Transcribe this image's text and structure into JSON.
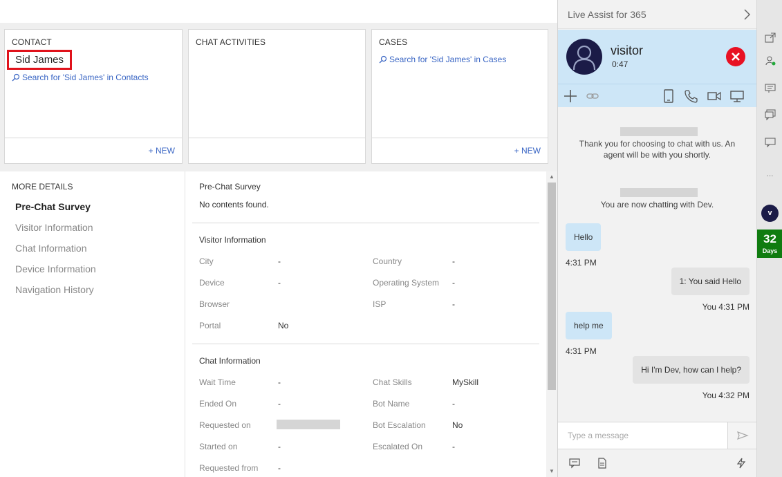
{
  "crm": {
    "contact_card": {
      "title": "CONTACT",
      "name": "Sid James",
      "search_link": "Search for 'Sid James' in Contacts",
      "new_label": "+ NEW"
    },
    "chat_activities_card": {
      "title": "CHAT ACTIVITIES"
    },
    "cases_card": {
      "title": "CASES",
      "search_link": "Search for 'Sid James' in Cases",
      "new_label": "+ NEW"
    },
    "more_details": {
      "header": "MORE DETAILS",
      "items": [
        "Pre-Chat Survey",
        "Visitor Information",
        "Chat Information",
        "Device Information",
        "Navigation History"
      ]
    },
    "pre_chat": {
      "title": "Pre-Chat Survey",
      "empty_text": "No contents found."
    },
    "visitor_info": {
      "title": "Visitor Information",
      "fields": [
        {
          "label": "City",
          "value": "-"
        },
        {
          "label": "Country",
          "value": "-"
        },
        {
          "label": "Device",
          "value": "-"
        },
        {
          "label": "Operating System",
          "value": "-"
        },
        {
          "label": "Browser",
          "value": ""
        },
        {
          "label": "ISP",
          "value": "-"
        },
        {
          "label": "Portal",
          "value": "No"
        }
      ]
    },
    "chat_info": {
      "title": "Chat Information",
      "fields": [
        {
          "label": "Wait Time",
          "value": "-"
        },
        {
          "label": "Chat Skills",
          "value": "MySkill"
        },
        {
          "label": "Ended On",
          "value": "-"
        },
        {
          "label": "Bot Name",
          "value": "-"
        },
        {
          "label": "Requested on",
          "value": ""
        },
        {
          "label": "Bot Escalation",
          "value": "No"
        },
        {
          "label": "Started on",
          "value": "-"
        },
        {
          "label": "Escalated On",
          "value": "-"
        },
        {
          "label": "Requested from",
          "value": "-"
        }
      ]
    }
  },
  "live_assist": {
    "title": "Live Assist for 365",
    "visitor": {
      "name": "visitor",
      "duration": "0:47"
    },
    "messages": {
      "sys1": "Thank you for choosing to chat with us. An agent will be with you shortly.",
      "sys2": "You are now chatting with Dev.",
      "m1": {
        "text": "Hello",
        "time": "4:31 PM"
      },
      "m2": {
        "text": "1: You said Hello",
        "time": "You 4:31 PM"
      },
      "m3": {
        "text": "help me",
        "time": "4:31 PM"
      },
      "m4": {
        "text": "Hi I'm Dev, how can I help?",
        "time": "You 4:32 PM"
      }
    },
    "composer": {
      "placeholder": "Type a message"
    }
  },
  "rail": {
    "more": "...",
    "badge": "v",
    "days_num": "32",
    "days_label": "Days"
  },
  "colors": {
    "accent_blue": "#cde6f7",
    "link": "#3a66c4",
    "end_red": "#e81123",
    "days_green": "#107c10",
    "highlight_red": "#e0121b"
  },
  "icons": [
    "search-icon",
    "chevron-right-icon",
    "avatar-person-icon",
    "close-icon",
    "plus-icon",
    "link-icon",
    "mobile-icon",
    "phone-icon",
    "video-icon",
    "screen-icon",
    "send-icon",
    "comment-icon",
    "note-icon",
    "lightning-icon"
  ]
}
